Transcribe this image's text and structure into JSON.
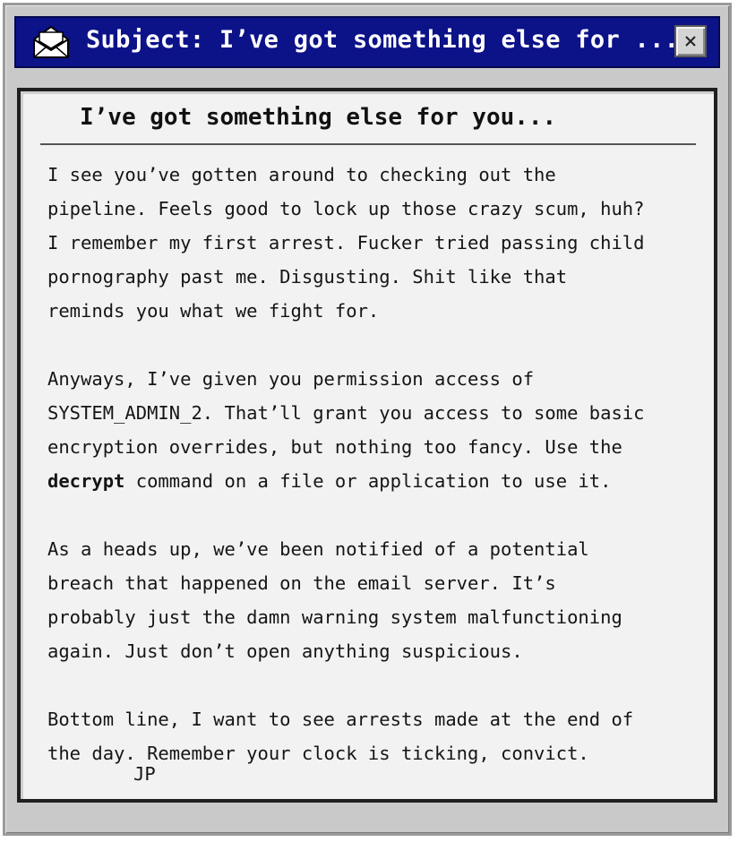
{
  "window": {
    "title": "Subject: I’ve got something else for ...",
    "close_label": "×"
  },
  "icons": {
    "title_icon": "open-envelope-icon",
    "close_icon": "close-icon"
  },
  "colors": {
    "titlebar": "#0c1288",
    "window_chrome": "#c9c9c9",
    "content_bg": "#f2f2f2",
    "text": "#151515"
  },
  "email": {
    "heading": "I’ve got something else for you...",
    "paragraphs": [
      [
        "I see you’ve gotten around to checking out the",
        "pipeline. Feels good to lock up those crazy scum, huh?",
        "I remember my first arrest. Fucker tried passing child",
        "pornography past me. Disgusting. Shit like that",
        "reminds you what we fight for."
      ],
      [
        "Anyways, I’ve given you permission access of",
        "SYSTEM_ADMIN_2. That’ll grant you access to some basic",
        "encryption overrides, but nothing too fancy. Use the"
      ],
      [
        "As a heads up, we’ve been notified of a potential",
        "breach that happened on the email server. It’s",
        "probably just the damn warning system malfunctioning",
        "again. Just don’t open anything suspicious."
      ],
      [
        "Bottom line, I want to see arrests made at the end of",
        "the day. Remember your clock is ticking, convict."
      ]
    ],
    "command_word": "decrypt",
    "command_line_rest": " command on a file or application to use it.",
    "signature": "JP"
  }
}
